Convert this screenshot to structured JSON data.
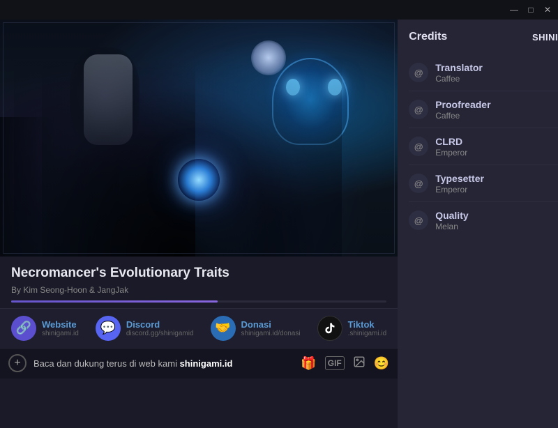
{
  "titlebar": {
    "minimize_label": "—",
    "maximize_label": "□",
    "close_label": "✕"
  },
  "manga": {
    "title": "Necromancer's Evolutionary Traits",
    "author": "By Kim Seong-Hoon & JangJak",
    "progress_percent": 55
  },
  "credits": {
    "section_title": "Credits",
    "site_name": "SHINIGAMI ID",
    "rows": [
      {
        "role": "Translator",
        "name": "Caffee"
      },
      {
        "role": "Proofreader",
        "name": "Caffee"
      },
      {
        "role": "CLRD",
        "name": "Emperor"
      },
      {
        "role": "Typesetter",
        "name": "Emperor"
      },
      {
        "role": "Quality",
        "name": "Melan"
      }
    ]
  },
  "socials": [
    {
      "label": "Website",
      "url": "shinigami.id",
      "icon": "🔗",
      "bg": "#5b4fcf"
    },
    {
      "label": "Discord",
      "url": "discord.gg/shinigamid",
      "icon": "💬",
      "bg": "#5865f2"
    },
    {
      "label": "Donasi",
      "url": "shinigami.id/donasi",
      "icon": "🤝",
      "bg": "#3a8fd1"
    },
    {
      "label": "Tiktok",
      "url": ".shinigami.id",
      "icon": "♪",
      "bg": "#111"
    }
  ],
  "bottom_bar": {
    "text_plain": "Baca dan dukung terus di web kami ",
    "text_bold": "shinigami.id",
    "add_label": "+",
    "icons": [
      "🎁",
      "GIF",
      "📷",
      "😊"
    ]
  }
}
